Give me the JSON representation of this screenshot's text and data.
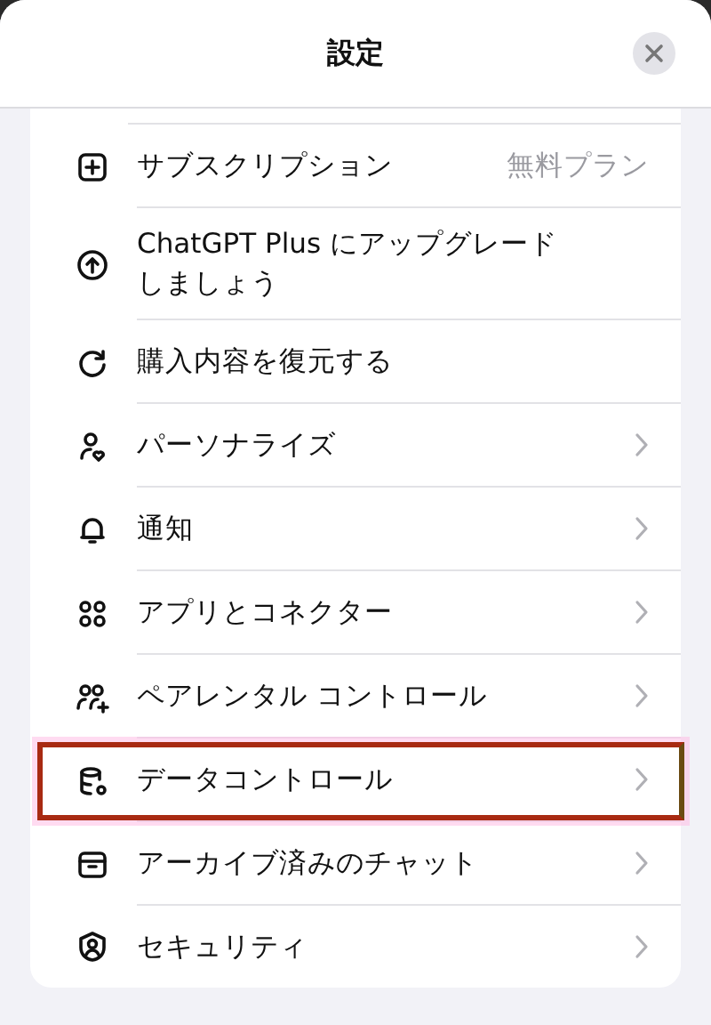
{
  "header": {
    "title": "設定"
  },
  "items": [
    {
      "kind": "value",
      "label": "サブスクリプション",
      "value": "無料プラン",
      "highlighted": false
    },
    {
      "kind": "action",
      "label": "ChatGPT Plus にアップグレードしましょう",
      "highlighted": false
    },
    {
      "kind": "action",
      "label": "購入内容を復元する",
      "highlighted": false
    },
    {
      "kind": "link",
      "label": "パーソナライズ",
      "highlighted": false
    },
    {
      "kind": "link",
      "label": "通知",
      "highlighted": false
    },
    {
      "kind": "link",
      "label": "アプリとコネクター",
      "highlighted": false
    },
    {
      "kind": "link",
      "label": "ペアレンタル コントロール",
      "highlighted": false
    },
    {
      "kind": "link",
      "label": "データコントロール",
      "highlighted": true
    },
    {
      "kind": "link",
      "label": "アーカイブ済みのチャット",
      "highlighted": false
    },
    {
      "kind": "link",
      "label": "セキュリティ",
      "highlighted": false
    }
  ]
}
